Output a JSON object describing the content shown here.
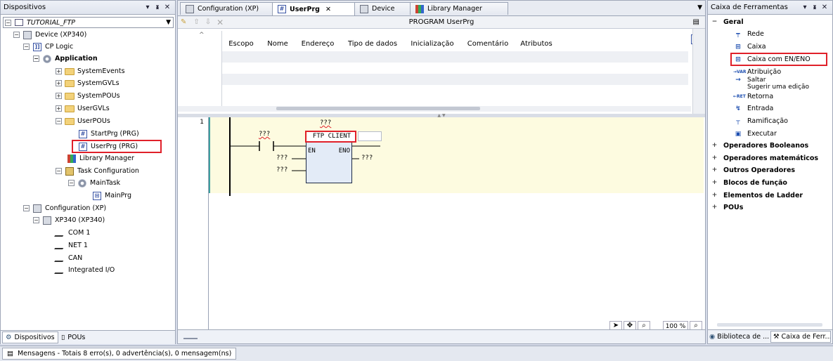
{
  "devices_panel": {
    "title": "Dispositivos",
    "pin": "▾  ⊥  ✕",
    "root": "TUTORIAL_FTP",
    "tree": [
      {
        "label": "Device (XP340)"
      },
      {
        "label": "CP Logic"
      },
      {
        "label": "Application"
      },
      {
        "label": "SystemEvents"
      },
      {
        "label": "SystemGVLs"
      },
      {
        "label": "SystemPOUs"
      },
      {
        "label": "UserGVLs"
      },
      {
        "label": "UserPOUs"
      },
      {
        "label": "StartPrg (PRG)"
      },
      {
        "label": "UserPrg (PRG)"
      },
      {
        "label": "Library Manager"
      },
      {
        "label": "Task Configuration"
      },
      {
        "label": "MainTask"
      },
      {
        "label": "MainPrg"
      },
      {
        "label": "Configuration (XP)"
      },
      {
        "label": "XP340 (XP340)"
      },
      {
        "label": "COM 1"
      },
      {
        "label": "NET 1"
      },
      {
        "label": "CAN"
      },
      {
        "label": "Integrated I/O"
      }
    ],
    "bottom_tabs": [
      "Dispositivos",
      "POUs"
    ]
  },
  "editor": {
    "tabs": [
      "Configuration (XP)",
      "UserPrg",
      "Device",
      "Library Manager"
    ],
    "tab_close": "✕",
    "program_header": "PROGRAM UserPrg",
    "columns": [
      "Escopo",
      "Nome",
      "Endereço",
      "Tipo de dados",
      "Inicialização",
      "Comentário",
      "Atributos"
    ],
    "rung_number": "1",
    "contact_label": "???",
    "block_instance": "???",
    "block_name": "FTP CLIENT",
    "pin_en": "EN",
    "pin_eno": "ENO",
    "input1": "???",
    "input2": "???",
    "output1": "???",
    "zoom": "100 %"
  },
  "toolbox": {
    "title": "Caixa de Ferramentas",
    "geral": "Geral",
    "items": [
      "Rede",
      "Caixa",
      "Caixa com EN/ENO",
      "Atribuição",
      "Saltar",
      "Sugerir uma edição",
      "Retorna",
      "Entrada",
      "Ramificação",
      "Executar"
    ],
    "categories": [
      "Operadores Booleanos",
      "Operadores matemáticos",
      "Outros Operadores",
      "Blocos de função",
      "Elementos de Ladder",
      "POUs"
    ],
    "bottom_tabs": [
      "Biblioteca de ...",
      "Caixa de Ferr..."
    ]
  },
  "status_bar": {
    "messages": "Mensagens - Totais 8 erro(s), 0 advertência(s), 0 mensagem(ns)"
  }
}
